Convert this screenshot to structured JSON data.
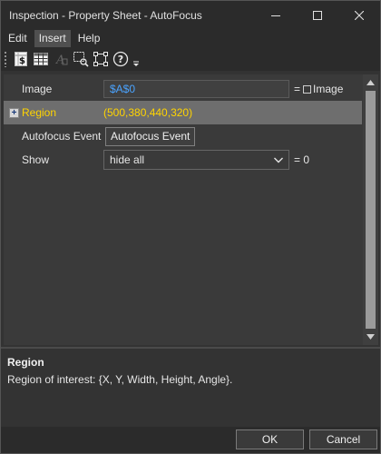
{
  "window": {
    "title": "Inspection - Property Sheet - AutoFocus"
  },
  "menu": {
    "items": [
      {
        "label": "Edit"
      },
      {
        "label": "Insert",
        "active": true
      },
      {
        "label": "Help"
      }
    ]
  },
  "toolbar": {
    "buttons": [
      {
        "icon": "dollar-sheet-icon"
      },
      {
        "icon": "table-grid-icon"
      },
      {
        "icon": "font-disabled-icon"
      },
      {
        "icon": "zoom-region-icon"
      },
      {
        "icon": "select-region-icon"
      },
      {
        "icon": "help-icon",
        "label": "?"
      },
      {
        "icon": "overflow-chevron-icon"
      }
    ]
  },
  "properties": {
    "image": {
      "name": "Image",
      "value": "$A$0",
      "suffix": "= ",
      "suffix_type": "Image"
    },
    "region": {
      "name": "Region",
      "value": "(500,380,440,320)",
      "expand": "+"
    },
    "autofocus_event": {
      "name": "Autofocus Event",
      "button_label": "Autofocus Event"
    },
    "show": {
      "name": "Show",
      "selected": "hide all",
      "suffix": "= 0"
    }
  },
  "description": {
    "title": "Region",
    "text": "Region of interest: {X, Y, Width, Height, Angle}."
  },
  "buttons": {
    "ok": "OK",
    "cancel": "Cancel"
  },
  "colors": {
    "accent_value": "#4aa3ff",
    "selected_text": "#ffd400",
    "selected_row": "#6e6e6e"
  }
}
